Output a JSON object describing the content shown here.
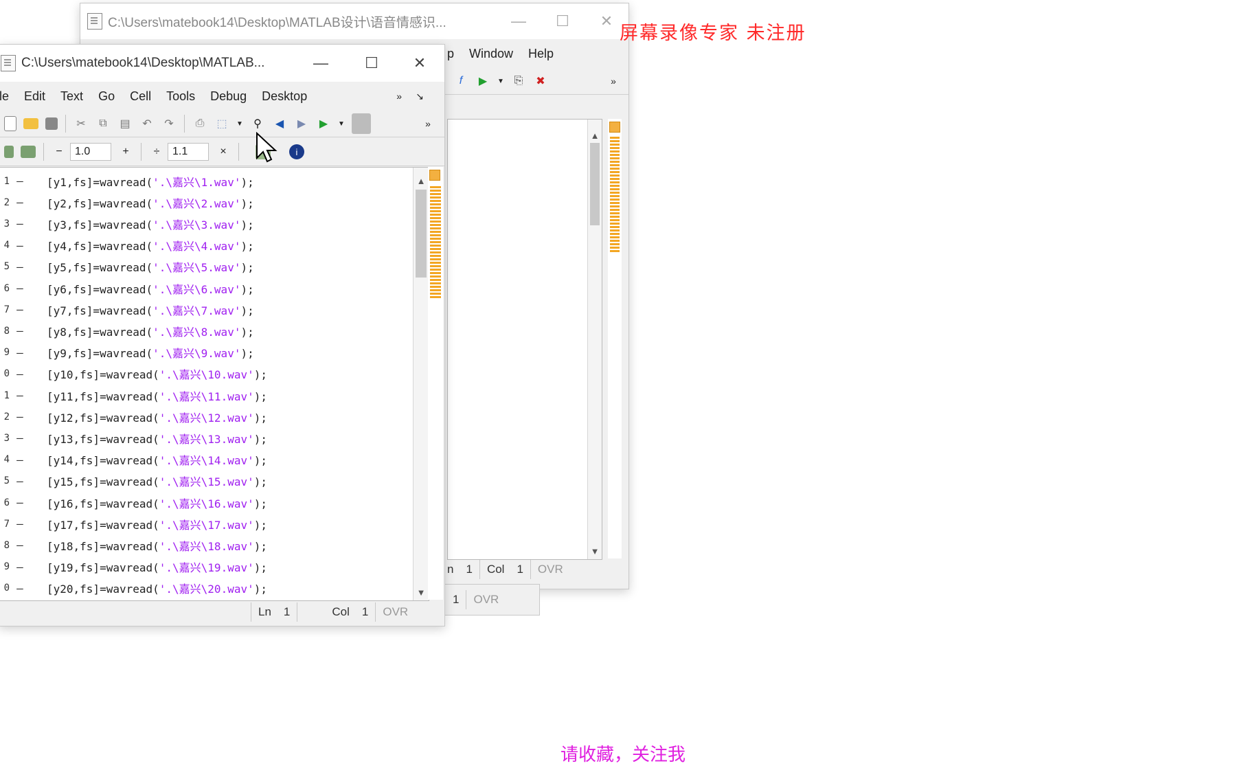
{
  "watermark": "屏幕录像专家  未注册",
  "caption": "请收藏，关注我",
  "back_window": {
    "title": "C:\\Users\\matebook14\\Desktop\\MATLAB设计\\语音情感识...",
    "menu": [
      "p",
      "Window",
      "Help"
    ],
    "status": {
      "ln_label": "n",
      "ln": "1",
      "col_label": "Col",
      "col": "1",
      "ovr": "OVR"
    },
    "status2": {
      "col": "1",
      "ovr": "OVR"
    }
  },
  "front_window": {
    "title": "C:\\Users\\matebook14\\Desktop\\MATLAB...",
    "menu": [
      "le",
      "Edit",
      "Text",
      "Go",
      "Cell",
      "Tools",
      "Debug",
      "Desktop"
    ],
    "cell_toolbar": {
      "minus": "−",
      "value1": "1.0",
      "plus": "+",
      "div": "÷",
      "value2": "1.1",
      "times": "×"
    },
    "status": {
      "ln_label": "Ln",
      "ln": "1",
      "col_label": "Col",
      "col": "1",
      "ovr": "OVR"
    },
    "lines": [
      {
        "n": "1",
        "pre": "[y1,fs]=wavread(",
        "str": "'.\\嘉兴\\1.wav'",
        "post": ");"
      },
      {
        "n": "2",
        "pre": "[y2,fs]=wavread(",
        "str": "'.\\嘉兴\\2.wav'",
        "post": ");"
      },
      {
        "n": "3",
        "pre": "[y3,fs]=wavread(",
        "str": "'.\\嘉兴\\3.wav'",
        "post": ");"
      },
      {
        "n": "4",
        "pre": "[y4,fs]=wavread(",
        "str": "'.\\嘉兴\\4.wav'",
        "post": ");"
      },
      {
        "n": "5",
        "pre": "[y5,fs]=wavread(",
        "str": "'.\\嘉兴\\5.wav'",
        "post": ");"
      },
      {
        "n": "6",
        "pre": "[y6,fs]=wavread(",
        "str": "'.\\嘉兴\\6.wav'",
        "post": ");"
      },
      {
        "n": "7",
        "pre": "[y7,fs]=wavread(",
        "str": "'.\\嘉兴\\7.wav'",
        "post": ");"
      },
      {
        "n": "8",
        "pre": "[y8,fs]=wavread(",
        "str": "'.\\嘉兴\\8.wav'",
        "post": ");"
      },
      {
        "n": "9",
        "pre": "[y9,fs]=wavread(",
        "str": "'.\\嘉兴\\9.wav'",
        "post": ");"
      },
      {
        "n": "0",
        "pre": "[y10,fs]=wavread(",
        "str": "'.\\嘉兴\\10.wav'",
        "post": ");"
      },
      {
        "n": "1",
        "pre": "[y11,fs]=wavread(",
        "str": "'.\\嘉兴\\11.wav'",
        "post": ");"
      },
      {
        "n": "2",
        "pre": "[y12,fs]=wavread(",
        "str": "'.\\嘉兴\\12.wav'",
        "post": ");"
      },
      {
        "n": "3",
        "pre": "[y13,fs]=wavread(",
        "str": "'.\\嘉兴\\13.wav'",
        "post": ");"
      },
      {
        "n": "4",
        "pre": "[y14,fs]=wavread(",
        "str": "'.\\嘉兴\\14.wav'",
        "post": ");"
      },
      {
        "n": "5",
        "pre": "[y15,fs]=wavread(",
        "str": "'.\\嘉兴\\15.wav'",
        "post": ");"
      },
      {
        "n": "6",
        "pre": "[y16,fs]=wavread(",
        "str": "'.\\嘉兴\\16.wav'",
        "post": ");"
      },
      {
        "n": "7",
        "pre": "[y17,fs]=wavread(",
        "str": "'.\\嘉兴\\17.wav'",
        "post": ");"
      },
      {
        "n": "8",
        "pre": "[y18,fs]=wavread(",
        "str": "'.\\嘉兴\\18.wav'",
        "post": ");"
      },
      {
        "n": "9",
        "pre": "[y19,fs]=wavread(",
        "str": "'.\\嘉兴\\19.wav'",
        "post": ");"
      },
      {
        "n": "0",
        "pre": "[y20,fs]=wavread(",
        "str": "'.\\嘉兴\\20.wav'",
        "post": ");"
      }
    ]
  },
  "colors": {
    "string": "#a020f0",
    "watermark": "#ff2a2a",
    "caption": "#e020e0",
    "mlint": "#f3a623"
  }
}
